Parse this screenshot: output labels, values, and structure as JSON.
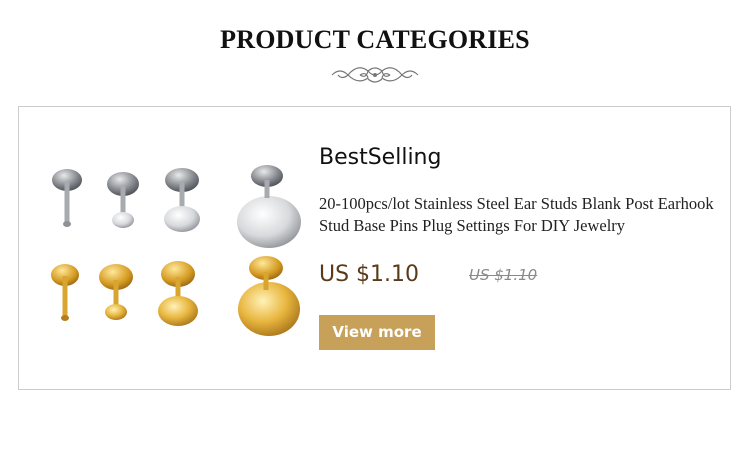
{
  "header": {
    "title": "PRODUCT CATEGORIES"
  },
  "card": {
    "section_label": "BestSelling",
    "product_title": "20-100pcs/lot Stainless Steel Ear Studs Blank Post Earhook Stud Base Pins Plug Settings For DIY Jewelry",
    "current_price": "US $1.10",
    "original_price": "US $1.10",
    "button_label": "View more",
    "image_icon": "ear-stud-blank-posts-image"
  },
  "colors": {
    "accent": "#c7a05a",
    "price": "#5a3a18",
    "strike_price": "#8a8a8a",
    "border": "#cccccc",
    "silver": "#c9cbce",
    "gold": "#d9a531"
  }
}
